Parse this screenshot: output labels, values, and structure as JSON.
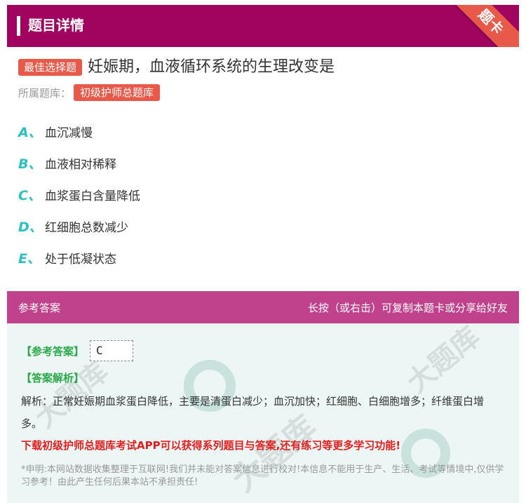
{
  "header": {
    "title": "题目详情",
    "ribbon": "题卡",
    "accent_color": "#a0045f"
  },
  "question": {
    "type_tag": "最佳选择题",
    "text": "妊娠期，血液循环系统的生理改变是",
    "bank_label": "所属题库：",
    "bank_name": "初级护师总题库"
  },
  "options": [
    {
      "letter": "A、",
      "text": "血沉减慢"
    },
    {
      "letter": "B、",
      "text": "血液相对稀释"
    },
    {
      "letter": "C、",
      "text": "血浆蛋白含量降低"
    },
    {
      "letter": "D、",
      "text": "红细胞总数减少"
    },
    {
      "letter": "E、",
      "text": "处于低凝状态"
    }
  ],
  "answer_section": {
    "title": "参考答案",
    "hint": "长按（或右击）可复制本题卡或分享给好友",
    "ref_label": "【参考答案】",
    "ref_value": "C",
    "analysis_label": "【答案解析】",
    "analysis_text": "解析：正常妊娠期血浆蛋白降低，主要是清蛋白减少；血沉加快；红细胞、白细胞增多；纤维蛋白增多。",
    "promo": "下载初级护师总题库考试APP可以获得系列题目与答案,还有练习等更多学习功能!",
    "disclaimer": "*申明:本网站数据收集整理于互联网!我们并未能对答案信息进行校对!本信息不能用于生产、生活、考试等情境中,仅供学习参考！由此产生任何后果本站不承担责任!"
  },
  "watermark": "大题库"
}
